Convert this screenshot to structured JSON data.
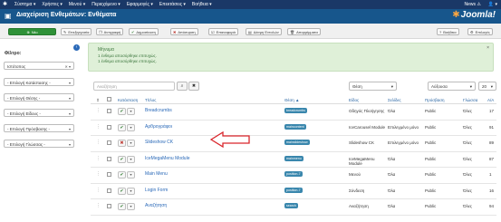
{
  "topnav": {
    "menu": [
      "Σύστημα ▾",
      "Χρήστες ▾",
      "Μενού ▾",
      "Περιεχόμενο ▾",
      "Εφαρμογές ▾",
      "Επεκτάσεις ▾",
      "Βοήθεια ▾"
    ],
    "right": [
      "News ⚠",
      "👤 ▾"
    ]
  },
  "header": {
    "title": "Διαχείριση Ενθεμάτων: Ενθέματα",
    "logo": "Joomla!"
  },
  "toolbar": {
    "new": "Νέο",
    "edit": "Επεξεργασία",
    "duplicate": "Αντιγραφή",
    "publish": "Δημοσίευση",
    "unpublish": "Απόσυρση",
    "checkin": "Επαναφορά",
    "batch": "Δέσμη Εντολών",
    "trash": "Απορρίμματα",
    "help": "Βοήθεια",
    "options": "Επιλογές"
  },
  "sidebar": {
    "filters_label": "Φίλτρο:",
    "client_value": "Ιστότοπος",
    "filters": [
      "- Επιλογή Κατάστασης -",
      "- Επιλογή Θέσης -",
      "- Επιλογή Είδους -",
      "- Επιλογή Πρόσβασης -",
      "- Επιλογή Γλώσσας -"
    ]
  },
  "message": {
    "heading": "Μήνυμα",
    "line1": "1 ένθεμα αποσύρθηκε επιτυχώς.",
    "line2": "1 ένθεμα αποσύρθηκε επιτυχώς."
  },
  "search": {
    "placeholder": "Αναζήτηση",
    "sort_field": "Θέση",
    "sort_dir": "Αύξουσα",
    "limit": "20"
  },
  "table": {
    "headers": {
      "status": "Κατάσταση",
      "title": "Τίτλος",
      "position": "Θέση ▲",
      "type": "Είδος",
      "pages": "Σελίδες",
      "access": "Πρόσβαση",
      "language": "Γλώσσα",
      "id": "Α/Α"
    },
    "rows": [
      {
        "status": "✔",
        "state": "on",
        "title": "Breadcrumbs",
        "position": "breadcrumbs",
        "type": "Οδηγός Πλοήγησης",
        "type2": "",
        "pages": "Όλα",
        "access": "Public",
        "language": "Όλες",
        "id": "17"
      },
      {
        "status": "✔",
        "state": "on",
        "title": "Αρθρογράφοι",
        "position": "maincontent",
        "type": "IceCarousel Module",
        "type2": "",
        "pages": "Επιλεγμένο μόνο",
        "access": "Public",
        "language": "Όλες",
        "id": "91"
      },
      {
        "status": "✖",
        "state": "off",
        "title": "Slideshow CK",
        "position": "mainslideshow",
        "type": "Slideshow CK",
        "type2": "",
        "pages": "Επιλεγμένο μόνο",
        "access": "Public",
        "language": "Όλες",
        "id": "89"
      },
      {
        "status": "✔",
        "state": "on",
        "title": "IceMegaMenu Module",
        "position": "mainmenu",
        "type": "IceMegaMenu",
        "type2": "Module",
        "pages": "Όλα",
        "access": "Public",
        "language": "Όλες",
        "id": "87"
      },
      {
        "status": "✔",
        "state": "on",
        "title": "Main Menu",
        "position": "position-7",
        "type": "Μενού",
        "type2": "",
        "pages": "Όλα",
        "access": "Public",
        "language": "Όλες",
        "id": "1"
      },
      {
        "status": "✔",
        "state": "on",
        "title": "Login Form",
        "position": "position-7",
        "type": "Σύνδεση",
        "type2": "",
        "pages": "Όλα",
        "access": "Public",
        "language": "Όλες",
        "id": "16"
      },
      {
        "status": "✔",
        "state": "on",
        "title": "Αναζήτηση",
        "position": "search",
        "type": "Αναζήτηση",
        "type2": "",
        "pages": "Όλα",
        "access": "Public",
        "language": "Όλες",
        "id": "94"
      }
    ]
  },
  "colors": {
    "topnav": "#1a3867",
    "header": "#17568c",
    "new_button": "#2f9138",
    "message_bg": "#dff0d8",
    "link": "#2a69b8",
    "position_badge": "#3a87ad",
    "arrow": "#d9252b"
  }
}
